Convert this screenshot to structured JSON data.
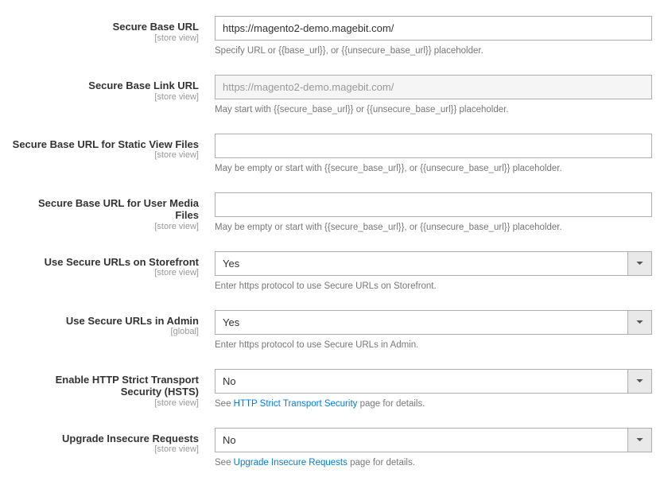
{
  "fields": {
    "secure_base_url": {
      "label": "Secure Base URL",
      "scope": "[store view]",
      "value": "https://magento2-demo.magebit.com/",
      "hint": "Specify URL or {{base_url}}, or {{unsecure_base_url}} placeholder."
    },
    "secure_base_link_url": {
      "label": "Secure Base Link URL",
      "scope": "[store view]",
      "value": "https://magento2-demo.magebit.com/",
      "hint": "May start with {{secure_base_url}} or {{unsecure_base_url}} placeholder."
    },
    "secure_base_url_static": {
      "label": "Secure Base URL for Static View Files",
      "scope": "[store view]",
      "value": "",
      "hint": "May be empty or start with {{secure_base_url}}, or {{unsecure_base_url}} placeholder."
    },
    "secure_base_url_media": {
      "label": "Secure Base URL for User Media Files",
      "scope": "[store view]",
      "value": "",
      "hint": "May be empty or start with {{secure_base_url}}, or {{unsecure_base_url}} placeholder."
    },
    "use_secure_storefront": {
      "label": "Use Secure URLs on Storefront",
      "scope": "[store view]",
      "value": "Yes",
      "hint": "Enter https protocol to use Secure URLs on Storefront."
    },
    "use_secure_admin": {
      "label": "Use Secure URLs in Admin",
      "scope": "[global]",
      "value": "Yes",
      "hint": "Enter https protocol to use Secure URLs in Admin."
    },
    "enable_hsts": {
      "label": "Enable HTTP Strict Transport Security (HSTS)",
      "scope": "[store view]",
      "value": "No",
      "hint_prefix": "See ",
      "hint_link": "HTTP Strict Transport Security",
      "hint_suffix": " page for details."
    },
    "upgrade_insecure": {
      "label": "Upgrade Insecure Requests",
      "scope": "[store view]",
      "value": "No",
      "hint_prefix": "See ",
      "hint_link": "Upgrade Insecure Requests",
      "hint_suffix": " page for details."
    }
  }
}
